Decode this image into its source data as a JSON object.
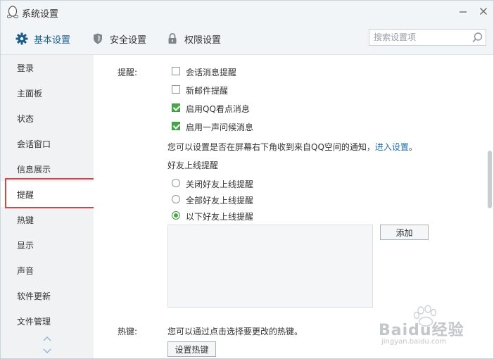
{
  "window": {
    "title": "系统设置"
  },
  "topnav": {
    "items": [
      {
        "label": "基本设置",
        "icon": "gear-icon",
        "active": true
      },
      {
        "label": "安全设置",
        "icon": "shield-icon",
        "active": false
      },
      {
        "label": "权限设置",
        "icon": "lock-icon",
        "active": false
      }
    ],
    "search_placeholder": "搜索设置项"
  },
  "sidebar": {
    "items": [
      {
        "label": "登录"
      },
      {
        "label": "主面板"
      },
      {
        "label": "状态"
      },
      {
        "label": "会话窗口"
      },
      {
        "label": "信息展示"
      },
      {
        "label": "提醒",
        "selected": true
      },
      {
        "label": "热键"
      },
      {
        "label": "显示"
      },
      {
        "label": "声音"
      },
      {
        "label": "软件更新"
      },
      {
        "label": "文件管理"
      }
    ]
  },
  "reminders": {
    "section_label": "提醒:",
    "options": [
      {
        "label": "会话消息提醒",
        "checked": false
      },
      {
        "label": "新邮件提醒",
        "checked": false
      },
      {
        "label": "启用QQ看点消息",
        "checked": true
      },
      {
        "label": "启用一声问候消息",
        "checked": true
      }
    ],
    "notice_text": "您可以设置是否在屏幕右下角收到来自QQ空间的通知，",
    "notice_link": "进入设置",
    "notice_end": "。",
    "friend_online_title": "好友上线提醒",
    "radios": [
      {
        "label": "关闭好友上线提醒",
        "checked": false
      },
      {
        "label": "全部好友上线提醒",
        "checked": false
      },
      {
        "label": "以下好友上线提醒",
        "checked": true
      }
    ],
    "add_button": "添加"
  },
  "hotkeys": {
    "section_label": "热键:",
    "description": "您可以通过点击选择要更改的热键。",
    "button": "设置热键"
  },
  "watermark": {
    "logo_text": "Baidu经验",
    "url_text": "jingyan.baidu.com"
  },
  "colors": {
    "accent": "#1a5d8c",
    "check_green": "#4aa64a",
    "link_blue": "#1e6fb2",
    "highlight_red": "#d64545"
  }
}
